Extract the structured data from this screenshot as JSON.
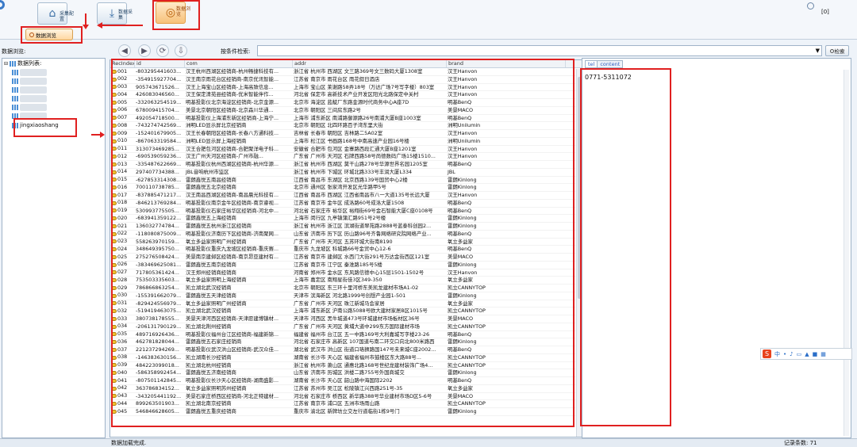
{
  "toolbar": {
    "btn1": "采集配置",
    "btn2": "数据采集",
    "btn3": "数据浏览",
    "version": "[0]",
    "browse_tab": "数据浏览"
  },
  "left": {
    "label": "数据浏览:",
    "root": "数据列表:",
    "selected": "jingxiaoshang"
  },
  "filter": {
    "label": "按条件检索:",
    "search": "检索"
  },
  "columns": [
    "RecIndex",
    "id",
    "com",
    "addr",
    "brand"
  ],
  "detail": {
    "tabs": [
      "tel",
      "content"
    ],
    "value": "0771-5311072"
  },
  "status": {
    "left": "数据加载完成.",
    "right": "记录条数: 71"
  },
  "rows": [
    [
      "001",
      "-803295441603...",
      "汉王杭州西湖区经销商-杭州畅捷科技有...",
      "浙江省 杭州市 西湖区 文三路369号文三数码大厦1308室",
      "汉王Hanvon"
    ],
    [
      "002",
      "-354915927704...",
      "汉王南京雨花台区经销商-南京优讯智能...",
      "江苏省 南京市 雨花台区 雨花假日酒店",
      "汉王Hanvon"
    ],
    [
      "003",
      "905743671526...",
      "汉王上海宝山区经销商-上海高致信息...",
      "上海市 宝山区 莱谢路58弄18号（万达广场7号写字楼）803室",
      "汉王Hanvon"
    ],
    [
      "004",
      "426083046560...",
      "汉王保定清苑县经销商-优米智能伴作...",
      "河北省 保定市 高新技术产业开发区阳光北路保定中关村",
      "汉王Hanvon"
    ],
    [
      "005",
      "-332063254519...",
      "明基投影仪北京海淀区经销商-北京金源...",
      "北京市 海淀区 蓝靛厂东路金源时代商务中心A座7D",
      "明基BenQ"
    ],
    [
      "006",
      "678009415704...",
      "美景北京朝阳区经销商-北京森川华通...",
      "北京市 朝阳区 三间房东路2号",
      "美景MACO"
    ],
    [
      "007",
      "492054718500...",
      "明基投影仪上海浦东新区经销商-上海宁...",
      "上海市 浦东新区 南浦路御源路26号南浦大厦B座1003室",
      "明基BenQ"
    ],
    [
      "008",
      "-743274742569...",
      "洲明LED显示屏北京经销商",
      "北京市 朝阳区 北四环路百子湾东里大街",
      "洲明Unilumin"
    ],
    [
      "009",
      "-152401679905...",
      "汉王长春朝阳区经销商-长春八方通科技...",
      "吉林省 长春市 朝阳区 吉林路二5A02室",
      "汉王Hanvon"
    ],
    [
      "010",
      "-867063319584...",
      "洲明LED显示屏上海经销商",
      "上海市 松江区 书画路168号中南高速产业园16号楼",
      "洲明Unilumin"
    ],
    [
      "011",
      "313073469285...",
      "汉王合肥包河区经销商-合肥聚洋电子科...",
      "安徽省 合肥市 包河区 金寨路西段汇通大厦B座1201室",
      "汉王Hanvon"
    ],
    [
      "012",
      "-690539059236...",
      "汉王广州天河区经销商-广州市融...",
      "广东省 广州市 天河区 石牌西路58号尚德数码广场15楼1510...",
      "汉王Hanvon"
    ],
    [
      "013",
      "-335487622669...",
      "明基投影仪杭州西湖区经销商-杭州华源...",
      "浙江省 杭州市 西湖区 莫干山路278号华源世界名园1205室",
      "明基BenQ"
    ],
    [
      "014",
      "297407734388...",
      "JBL音响杭州市监区",
      "浙江省 杭州市 下城区 环城北路333号丰润大厦L334",
      "JBL"
    ],
    [
      "015",
      "-627853314308...",
      "雷朗鑫悦五南昌经销商",
      "江西省 南昌市 东湖区 北京西路139号国贸中心2楼",
      "雷朗Kinlong"
    ],
    [
      "016",
      "700110738785...",
      "雷朗鑫悦五北京经销商",
      "北京市 通州区 张家湾开发区光华路甲5号",
      "雷朗Kinlong"
    ],
    [
      "017",
      "-837885471217...",
      "汉王南昌西湖区经销商-南昌晨光科技有...",
      "江西省 南昌市 西湖区 江西省南昌市八一大道135号长远大厦",
      "汉王Hanvon"
    ],
    [
      "018",
      "-846213769284...",
      "明基投影仪南京金牛区经销商-南京睿视...",
      "江苏省 南京市 金牛区 成洛路60号成洛大厦1508",
      "明基BenQ"
    ],
    [
      "019",
      "530993775505...",
      "明基投影仪石家庄裕华区经销商-河北中...",
      "河北省 石家庄市 裕华区 裕翔街69号金石智能大厦C座0108号",
      "明基BenQ"
    ],
    [
      "020",
      "-683941359122...",
      "雷朗鑫悦五上海经销商",
      "上海市 闵行区 九亭镇蒲汇路951号2号楼",
      "雷朗Kinlong"
    ],
    [
      "021",
      "136032774784...",
      "雷朗鑫悦五杭州浙江区经销商",
      "浙江省 杭州市 浙江区 滨湖街道翠苑路2888号蓝泰科创园2...",
      "雷朗Kinlong"
    ],
    [
      "022",
      "-118080875009...",
      "明基投影仪济南历下区经销商-济南聚网...",
      "山东省 济南市 历下区 历山路96号齐鲁网络研究院网络产业...",
      "明基BenQ"
    ],
    [
      "023",
      "558263970159...",
      "氧立多益家照明广州经销商",
      "广东省 广州市 天河区 五苏环城大街南8190",
      "氧立多益家"
    ],
    [
      "024",
      "348649395750...",
      "明基投影仪重庆九龙坡区经销商-重庆赛...",
      "重庆市 九龙坡区 科城路66号金贸中心12-6",
      "明基BenQ"
    ],
    [
      "025",
      "275276508424...",
      "美景南京建邺区经销商-南京昂亚建材有...",
      "江苏省 南京市 建邺区 水西门大街291号万达金街西区121室",
      "美景MACO"
    ],
    [
      "026",
      "-383469625081...",
      "雷朗鑫悦五南京经销商",
      "江苏省 南京市 江宁区 秦淮路185号5楼",
      "雷朗Kinlong"
    ],
    [
      "027",
      "717805361424...",
      "汉王郑州经销商经销商",
      "河南省 郑州市 金水区 东风路信德中心15层1501-1502号",
      "汉王Hanvon"
    ],
    [
      "028",
      "753503335603...",
      "氧立多益家照明上海经销商",
      "上海市 嘉定区 南翔星街佳3区349-350",
      "氧立多益家"
    ],
    [
      "029",
      "786866863254...",
      "凯立湖北武汉经销商",
      "北京市 朝阳区 东三环十里河桥东美凯龙建材市场A1-02",
      "凯立CANNYTOP"
    ],
    [
      "030",
      "-155391662079...",
      "雷朗鑫悦五天津经销商",
      "天津市 滨海新区 河北路1999号创想产业园1-501",
      "雷朗Kinlong"
    ],
    [
      "031",
      "-829424556979...",
      "氧立多益家照明广州经销商",
      "广东省 广州市 天河区 珠江新城马会家居",
      "氧立多益家"
    ],
    [
      "032",
      "-519419463075...",
      "凯立湖北武汉经销商",
      "上海市 浦东新区 沪南公路5088号欧大建材家居B区1015号",
      "凯立CANNYTOP"
    ],
    [
      "033",
      "380738178555...",
      "美景天津河西区经销商-天津愿建博镇材...",
      "天津市 河西区 黑牛城道473号环城建材市场板材区36号",
      "美景MACO"
    ],
    [
      "034",
      "-206131790129...",
      "凯立湖北荆州经销商",
      "广东省 广州市 天河区 黄埔大道中299东方国际建材市场",
      "凯立CANNYTOP"
    ],
    [
      "035",
      "489716926436...",
      "明基投影仪福州台江区经销商-福建新锦...",
      "福建省 福州市 台江区 五一中路169号大利嘉城写字楼23-26",
      "明基BenQ"
    ],
    [
      "036",
      "462781828044...",
      "雷朗鑫悦五石家庄经销商",
      "河北省 石家庄市 高新区 107国道与南二环交口向北800米路西",
      "雷朗Kinlong"
    ],
    [
      "037",
      "221237294269...",
      "明基投影仪武汉洪山区经销商-武汉众佳...",
      "湖北省 武汉市 洪山区 街道口珞狮路国147号未来城C座2002...",
      "明基BenQ"
    ],
    [
      "038",
      "-146383630156...",
      "凯立湖南长沙经销商",
      "湖南省 长沙市 天心区 福建省福州市鼓楼区东大路88号...",
      "凯立CANNYTOP"
    ],
    [
      "039",
      "484223099018...",
      "凯立湖北杭州经销商",
      "浙江省 杭州市 萧山区 通惠北路168号世纪龙建材装饰广场4...",
      "凯立CANNYTOP"
    ],
    [
      "040",
      "-586358992454...",
      "雷朗鑫悦五济南经销商",
      "山东省 济南市 历城区 洪楼二路755号外国商城交",
      "雷朗Kinlong"
    ],
    [
      "041",
      "-807501142845...",
      "明基投影仪长沙天心区经销商-湖南盛影...",
      "湖南省 长沙市 天心区 韶山路中海国际2202",
      "明基BenQ"
    ],
    [
      "042",
      "363786834152...",
      "氧立多益家照明苏州经销商",
      "江苏省 苏州市 吴江区 松陵镇江兴西路251号-35",
      "氧立多益家"
    ],
    [
      "043",
      "-343205441192...",
      "美景石家庄桥西区经销商-河北正特建材...",
      "河北省 石家庄市 桥西区 新华路388号华业建材市场D区5-6号",
      "美景MACO"
    ],
    [
      "044",
      "899263501903...",
      "凯立湖北南京经销商",
      "江苏省 南京市 浦口区 五洲市场雨山路",
      "凯立CANNYTOP"
    ],
    [
      "045",
      "546846628605...",
      "雷朗鑫悦五重庆经销商",
      "重庆市 渝北区 新牌坊立交左行道临街1栋9号门",
      "雷朗Kinlong"
    ]
  ]
}
